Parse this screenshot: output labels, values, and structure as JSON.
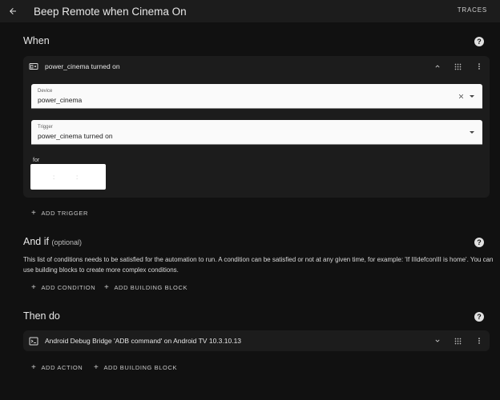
{
  "header": {
    "title": "Beep Remote when Cinema On",
    "traces_label": "TRACES"
  },
  "when": {
    "title": "When",
    "trigger_card": {
      "title": "power_cinema turned on",
      "device_field": {
        "label": "Device",
        "value": "power_cinema"
      },
      "trigger_field": {
        "label": "Trigger",
        "value": "power_cinema turned on"
      },
      "for_label": "for",
      "duration_separators": [
        ":",
        ":"
      ]
    },
    "add_trigger_label": "ADD TRIGGER"
  },
  "and_if": {
    "title": "And if",
    "optional_label": "(optional)",
    "description": "This list of conditions needs to be satisfied for the automation to run. A condition can be satisfied or not at any given time, for example: 'If IIIdefconIII is home'. You can use building blocks to create more complex conditions.",
    "add_condition_label": "ADD CONDITION",
    "add_building_block_label": "ADD BUILDING BLOCK"
  },
  "then_do": {
    "title": "Then do",
    "action_card": {
      "title": "Android Debug Bridge 'ADB command' on Android TV 10.3.10.13"
    },
    "add_action_label": "ADD ACTION",
    "add_building_block_label": "ADD BUILDING BLOCK"
  },
  "icons": {
    "back": "arrow-left-icon",
    "help": "help-circle-icon",
    "device": "remote-device-icon",
    "collapse": "chevron-up-icon",
    "expand": "chevron-down-icon",
    "drag": "drag-handle-icon",
    "menu": "dots-vertical-icon",
    "clear": "close-icon",
    "add": "plus-icon",
    "console": "console-icon"
  },
  "colors": {
    "background": "#111111",
    "topbar": "#1c1c1c",
    "card": "#1c1c1c",
    "field": "#fafafa",
    "text": "#e1e1e1"
  }
}
